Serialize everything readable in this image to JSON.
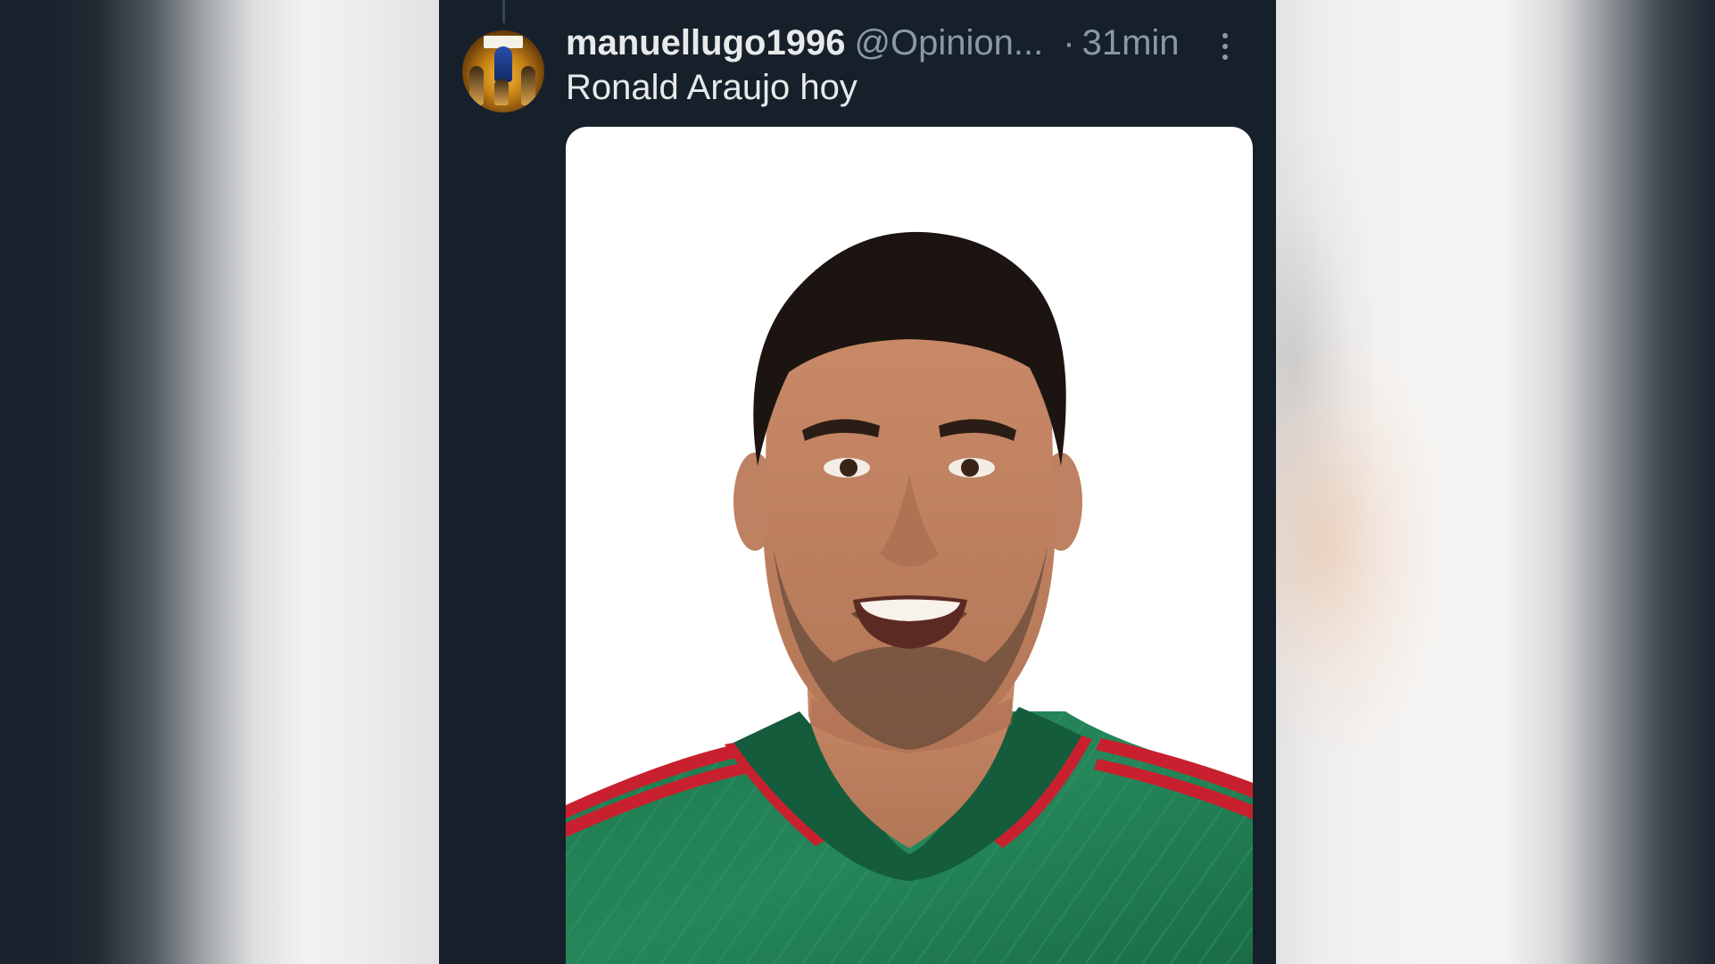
{
  "tweet": {
    "username": "manuellugo1996",
    "handle": "@Opinion...",
    "separator": "·",
    "time": "31min",
    "text": "Ronald Araujo hoy",
    "avatar_icon": "profile-avatar",
    "more_icon": "more-vertical-icon",
    "media_icon": "player-portrait-photo"
  },
  "colors": {
    "background": "#16202a",
    "primary_text": "#e7e9ea",
    "secondary_text": "#8b98a5",
    "jersey_green": "#1f7a4f",
    "jersey_red": "#c8202e"
  }
}
